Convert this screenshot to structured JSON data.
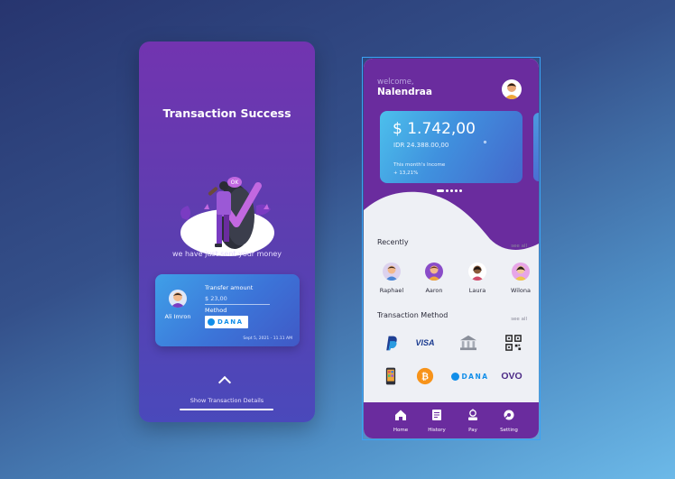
{
  "success_screen": {
    "title": "Transaction Success",
    "message": "we have just sent your money",
    "ok_badge": "OK",
    "receipt": {
      "recipient_name": "Ali Imron",
      "transfer_label": "Transfer amount",
      "transfer_amount": "$ 23,00",
      "method_label": "Method",
      "method_brand": "DANA",
      "date": "Sept 5, 2021 - 11.11 AM"
    },
    "show_details_label": "Show Transaction Details"
  },
  "home_screen": {
    "welcome": "welcome,",
    "username": "Nalendraa",
    "balance_card": {
      "amount": "$ 1.742,00",
      "idr": "IDR 24.388.00,00",
      "income_label": "This month's Income",
      "income_change": "+ 13,21%"
    },
    "recently": {
      "title": "Recently",
      "see_all": "see all",
      "contacts": [
        {
          "name": "Raphael"
        },
        {
          "name": "Aaron"
        },
        {
          "name": "Laura"
        },
        {
          "name": "Wilona"
        }
      ]
    },
    "transaction_method": {
      "title": "Transaction Method",
      "see_all": "see all",
      "methods": [
        {
          "name": "paypal",
          "icon": "paypal-icon"
        },
        {
          "name": "VISA",
          "icon": "visa-icon"
        },
        {
          "name": "bank",
          "icon": "bank-icon"
        },
        {
          "name": "qr",
          "icon": "qr-code-icon"
        },
        {
          "name": "phone",
          "icon": "mobile-phone-icon"
        },
        {
          "name": "bitcoin",
          "icon": "bitcoin-icon"
        },
        {
          "name": "DANA",
          "icon": "dana-icon"
        },
        {
          "name": "OVO",
          "icon": "ovo-icon"
        }
      ]
    },
    "nav": [
      {
        "label": "Home",
        "icon": "home-icon"
      },
      {
        "label": "History",
        "icon": "history-icon"
      },
      {
        "label": "Pay",
        "icon": "pay-icon"
      },
      {
        "label": "Setting",
        "icon": "setting-icon"
      }
    ]
  },
  "colors": {
    "purple": "#6a2c9e",
    "card_blue": "#4091de",
    "background": "#34508a"
  }
}
